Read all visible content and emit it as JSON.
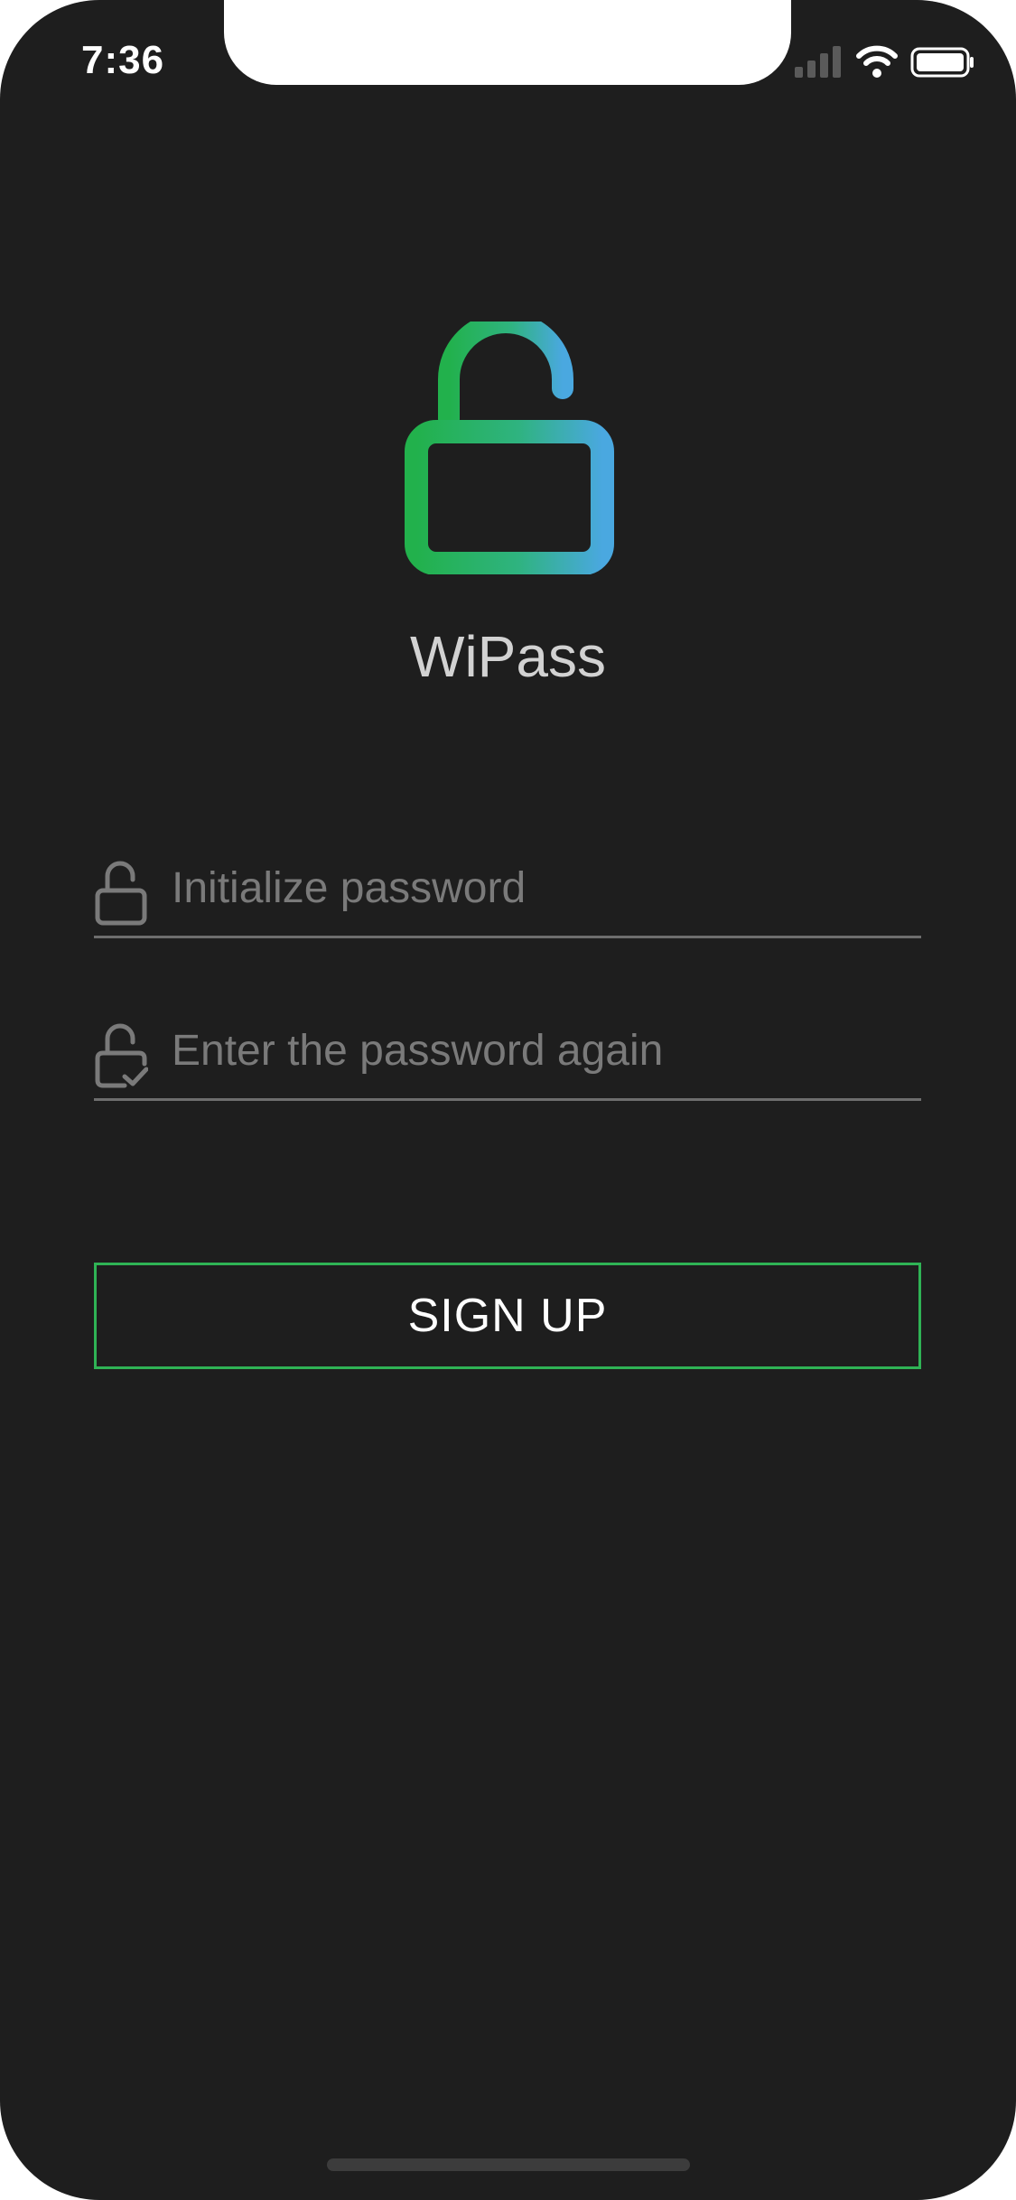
{
  "status_bar": {
    "time": "7:36",
    "signal_icon": "cellular-signal-icon",
    "wifi_icon": "wifi-icon",
    "battery_icon": "battery-icon"
  },
  "logo": {
    "icon": "unlocked-padlock-icon",
    "gradient_start": "#22b14c",
    "gradient_end": "#4aa8e0"
  },
  "app_name": "WiPass",
  "form": {
    "password": {
      "icon": "unlock-icon",
      "value": "",
      "placeholder": "Initialize password"
    },
    "confirm": {
      "icon": "lock-check-icon",
      "value": "",
      "placeholder": "Enter the password again"
    },
    "submit_label": "SIGN UP"
  },
  "colors": {
    "background": "#1e1e1e",
    "button_border": "#2fb355",
    "field_icon": "#7a7a7a"
  }
}
